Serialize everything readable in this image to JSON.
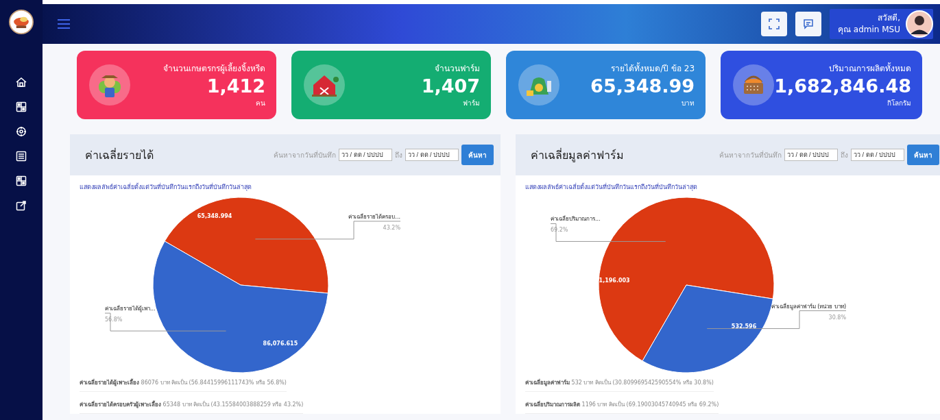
{
  "header": {
    "greeting": "สวัสดี,",
    "user": "คุณ admin MSU"
  },
  "stat_cards": [
    {
      "kind": "farmer",
      "color": "#f5325c",
      "label": "จำนวนเกษตรกรผู้เลี้ยงจิ้งหรีด",
      "value": "1,412",
      "unit": "คน"
    },
    {
      "kind": "barn",
      "color": "#14ad72",
      "label": "จำนวนฟาร์ม",
      "value": "1,407",
      "unit": "ฟาร์ม"
    },
    {
      "kind": "money",
      "color": "#2f86d9",
      "label": "รายได้ทั้งหมด/ปี ข้อ 23",
      "value": "65,348.99",
      "unit": "บาท"
    },
    {
      "kind": "basket",
      "color": "#2f4fe0",
      "label": "ปริมาณการผลิตทั้งหมด",
      "value": "1,682,846.48",
      "unit": "กิโลกรัม"
    }
  ],
  "panels": [
    {
      "title": "ค่าเฉลี่ยรายได้",
      "search_label": "ค้นหาจากวันที่บันทึก",
      "from": {
        "placeholder": "วว / ดด / ปปปป"
      },
      "to_label": "ถึง",
      "to": {
        "placeholder": "วว / ดด / ปปปป"
      },
      "button": "ค้นหา",
      "subtitle": "แสดงผลลัพธ์ค่าเฉลี่ยตั้งแต่วันที่บันทึกวันแรกถึงวันที่บันทึกวันล่าสุด",
      "chart_data": {
        "type": "pie",
        "categories": [
          "ค่าเฉลี่ยรายได้ครอบ...",
          "ค่าเฉลี่ยรายได้ผู้เพา..."
        ],
        "values": [
          65348.994,
          86076.615
        ],
        "value_labels": [
          "65,348.994",
          "86,076.615"
        ],
        "annotations": [
          "43.2%",
          "56.8%"
        ]
      },
      "summary": [
        "**ค่าเฉลี่ยรายได้ผู้เพาะเลี้ยง** 86076 บาท คิดเป็น (56.84415996111743% หรือ 56.8%)",
        "**ค่าเฉลี่ยรายได้ครอบครัวผู้เพาะเลี้ยง** 65348 บาท คิดเป็น (43.15584003888259 หรือ 43.2%)"
      ]
    },
    {
      "title": "ค่าเฉลี่ยมูลค่าฟาร์ม",
      "search_label": "ค้นหาจากวันที่บันทึก",
      "from": {
        "placeholder": "วว / ดด / ปปปป"
      },
      "to_label": "ถึง",
      "to": {
        "placeholder": "วว / ดด / ปปปป"
      },
      "button": "ค้นหา",
      "subtitle": "แสดงผลลัพธ์ค่าเฉลี่ยตั้งแต่วันที่บันทึกวันแรกถึงวันที่บันทึกวันล่าสุด",
      "chart_data": {
        "type": "pie",
        "categories": [
          "ค่าเฉลี่ยปริมาณการ...",
          "ค่าเฉลี่ยมูลค่าฟาร์ม (หน่วย บาท)"
        ],
        "values": [
          1196.003,
          532.596
        ],
        "value_labels": [
          "1,196.003",
          "532.596"
        ],
        "annotations": [
          "69.2%",
          "30.8%"
        ]
      },
      "summary": [
        "**ค่าเฉลี่ยมูลค่าฟาร์ม** 532 บาท คิดเป็น (30.809969542590554% หรือ 30.8%)",
        "**ค่าเฉลี่ยปริมาณการผลิต** 1196 บาท คิดเป็น (69.19003045740945 หรือ 69.2%)"
      ]
    }
  ]
}
